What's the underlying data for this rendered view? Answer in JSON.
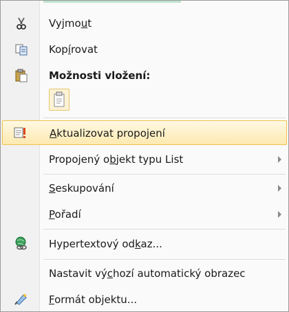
{
  "menu": {
    "cut": {
      "pre": "Vyjmo",
      "key": "u",
      "post": "t",
      "icon": "scissors-icon"
    },
    "copy": {
      "pre": "Kop",
      "key": "í",
      "post": "rovat",
      "icon": "copy-icon"
    },
    "paste_heading": {
      "label": "Možnosti vložení:",
      "icon": "clipboard-icon"
    },
    "paste_option": {
      "icon": "paste-keep-formatting-icon"
    },
    "update_link": {
      "pre": "",
      "key": "A",
      "post": "ktualizovat propojení",
      "icon": "update-link-icon"
    },
    "linked_object": {
      "pre": "Propojený o",
      "key": "b",
      "post": "jekt typu List"
    },
    "grouping": {
      "pre": "",
      "key": "S",
      "post": "eskupování"
    },
    "order": {
      "pre": "",
      "key": "P",
      "post": "ořadí"
    },
    "hyperlink": {
      "pre": "Hypertextový od",
      "key": "k",
      "post": "az...",
      "icon": "hyperlink-globe-icon"
    },
    "default_shape": {
      "pre": "Nastavit vý",
      "key": "c",
      "post": "hozí automatický obrazec"
    },
    "format_object": {
      "pre": "",
      "key": "F",
      "post": "ormát objektu...",
      "icon": "format-object-icon"
    }
  },
  "colors": {
    "highlight_border": "#f0c24f",
    "highlight_fill": "#fde9b0",
    "gutter": "#f1f1f1"
  }
}
